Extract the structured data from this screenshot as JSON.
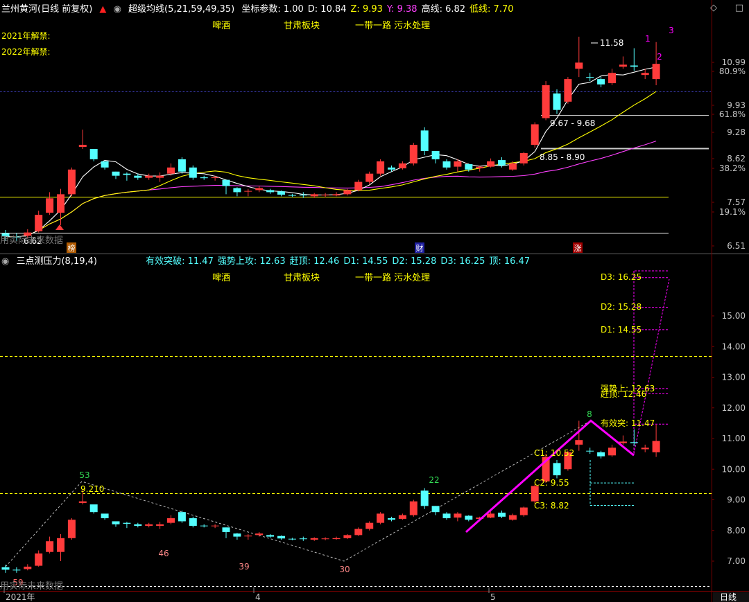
{
  "colors": {
    "up": "#ff3b3b",
    "down": "#54ffff",
    "ma5": "#ffffff",
    "ma21": "#ffff00",
    "ma59": "#ff40ff",
    "grid": "#7a0000",
    "axis_text": "#c8c8c8",
    "yellow": "#ffff00",
    "cyan": "#54ffff",
    "magenta": "#ff00ff"
  },
  "top_panel": {
    "title": "兰州黄河(日线 前复权)",
    "indicator": "超级均线(5,21,59,49,35)",
    "params": [
      {
        "label": "坐标参数: 1.00",
        "color": "#ffffff"
      },
      {
        "label": "D: 10.84",
        "color": "#ffffff"
      },
      {
        "label": "Z: 9.93",
        "color": "#ffff00"
      },
      {
        "label": "Y: 9.38",
        "color": "#ff40ff"
      },
      {
        "label": "高线: 6.82",
        "color": "#ffffff"
      },
      {
        "label": "低线: 7.70",
        "color": "#ffff00"
      }
    ],
    "tags": [
      "啤酒",
      "甘肃板块",
      "一带一路 污水处理"
    ],
    "notes": [
      "2021年解禁:",
      "2022年解禁:"
    ],
    "ann_high": "11.58",
    "ann_low": "6.62",
    "ann_range1": "9.67 - 9.68",
    "ann_range2": "8.85 - 8.90",
    "wave_marks": [
      "1",
      "2",
      "3"
    ],
    "events": [
      "榜",
      "财",
      "涨"
    ],
    "axis_ticks": [
      "10.99",
      "80.9%",
      "9.93",
      "61.8%",
      "9.28",
      "8.62",
      "38.2%",
      "7.57",
      "19.1%",
      "6.51"
    ],
    "ghost_text": "用实际未来数据"
  },
  "bottom_panel": {
    "title": "三点测压力(8,19,4)",
    "params": [
      {
        "label": "有效突破: 11.47",
        "color": "#54ffff"
      },
      {
        "label": "强势上攻: 12.63",
        "color": "#54ffff"
      },
      {
        "label": "赶顶: 12.46",
        "color": "#54ffff"
      },
      {
        "label": "D1: 14.55",
        "color": "#54ffff"
      },
      {
        "label": "D2: 15.28",
        "color": "#54ffff"
      },
      {
        "label": "D3: 16.25",
        "color": "#54ffff"
      },
      {
        "label": "顶: 16.47",
        "color": "#54ffff"
      }
    ],
    "tags": [
      "啤酒",
      "甘肃板块",
      "一带一路 污水处理"
    ],
    "levels": [
      "D3: 16.25",
      "D2: 15.28",
      "D1: 14.55",
      "强势上: 12.63",
      "赶顶: 12.46",
      "有效突: 11.47",
      "C1: 10.52",
      "C2: 9.55",
      "C3: 8.82"
    ],
    "counts": [
      "59",
      "53",
      "46",
      "39",
      "30",
      "22",
      "8"
    ],
    "label_9210": "9.210",
    "axis_ticks": [
      "15.00",
      "14.00",
      "13.00",
      "12.00",
      "11.00",
      "10.00",
      "9.00",
      "8.00",
      "7.00"
    ],
    "ghost_text": "用实际未来数据"
  },
  "x_axis": {
    "labels": [
      "2021年",
      "4",
      "5"
    ],
    "period": "日线"
  },
  "candles": [
    [
      6.8,
      6.72,
      6.88,
      6.62
    ],
    [
      6.72,
      6.7,
      6.8,
      6.62
    ],
    [
      6.74,
      6.82,
      6.9,
      6.7
    ],
    [
      6.85,
      7.25,
      7.35,
      6.82
    ],
    [
      7.3,
      7.65,
      7.8,
      7.25
    ],
    [
      7.3,
      7.75,
      7.88,
      7.0
    ],
    [
      7.75,
      8.35,
      8.4,
      7.7
    ],
    [
      8.9,
      8.95,
      9.32,
      8.85
    ],
    [
      8.85,
      8.6,
      8.65,
      8.55
    ],
    [
      8.55,
      8.4,
      8.5,
      8.35
    ],
    [
      8.3,
      8.2,
      8.3,
      8.12
    ],
    [
      8.25,
      8.22,
      8.28,
      8.08
    ],
    [
      8.2,
      8.15,
      8.25,
      8.1
    ],
    [
      8.15,
      8.2,
      8.25,
      8.1
    ],
    [
      8.15,
      8.2,
      8.28,
      8.05
    ],
    [
      8.25,
      8.4,
      8.5,
      8.2
    ],
    [
      8.6,
      8.3,
      8.65,
      8.25
    ],
    [
      8.4,
      8.15,
      8.45,
      8.1
    ],
    [
      8.16,
      8.14,
      8.2,
      8.1
    ],
    [
      8.15,
      8.16,
      8.2,
      8.08
    ],
    [
      8.1,
      7.95,
      8.1,
      7.75
    ],
    [
      7.9,
      7.8,
      7.92,
      7.7
    ],
    [
      7.82,
      7.83,
      7.88,
      7.7
    ],
    [
      7.85,
      7.9,
      7.95,
      7.8
    ],
    [
      7.85,
      7.8,
      7.88,
      7.76
    ],
    [
      7.82,
      7.74,
      7.84,
      7.7
    ],
    [
      7.73,
      7.72,
      7.76,
      7.68
    ],
    [
      7.74,
      7.72,
      7.8,
      7.66
    ],
    [
      7.7,
      7.75,
      7.78,
      7.66
    ],
    [
      7.72,
      7.74,
      7.78,
      7.68
    ],
    [
      7.72,
      7.75,
      7.8,
      7.7
    ],
    [
      7.75,
      7.85,
      7.88,
      7.72
    ],
    [
      7.85,
      8.05,
      8.1,
      7.82
    ],
    [
      8.05,
      8.25,
      8.3,
      8.0
    ],
    [
      8.25,
      8.55,
      8.6,
      8.2
    ],
    [
      8.4,
      8.35,
      8.45,
      8.3
    ],
    [
      8.38,
      8.5,
      8.55,
      8.35
    ],
    [
      8.5,
      8.95,
      9.0,
      8.45
    ],
    [
      9.3,
      8.8,
      9.38,
      8.7
    ],
    [
      8.8,
      8.6,
      8.8,
      8.5
    ],
    [
      8.55,
      8.4,
      8.6,
      8.35
    ],
    [
      8.42,
      8.55,
      8.6,
      8.3
    ],
    [
      8.48,
      8.35,
      8.5,
      8.3
    ],
    [
      8.38,
      8.42,
      8.45,
      8.3
    ],
    [
      8.42,
      8.55,
      8.62,
      8.4
    ],
    [
      8.58,
      8.45,
      8.65,
      8.4
    ],
    [
      8.35,
      8.5,
      8.55,
      8.32
    ],
    [
      8.5,
      8.75,
      8.78,
      8.45
    ],
    [
      8.95,
      9.45,
      9.5,
      8.88
    ],
    [
      9.6,
      10.4,
      10.5,
      9.55
    ],
    [
      10.2,
      9.8,
      10.3,
      9.7
    ],
    [
      10.0,
      10.55,
      10.6,
      9.95
    ],
    [
      10.8,
      10.95,
      11.58,
      10.6
    ],
    [
      10.6,
      10.58,
      10.7,
      10.5
    ],
    [
      10.55,
      10.42,
      10.6,
      10.35
    ],
    [
      10.45,
      10.7,
      10.8,
      10.4
    ],
    [
      10.85,
      10.9,
      11.1,
      10.8
    ],
    [
      10.88,
      10.85,
      11.3,
      10.75
    ],
    [
      10.65,
      10.7,
      10.8,
      10.55
    ],
    [
      10.55,
      10.92,
      11.45,
      10.4
    ]
  ]
}
